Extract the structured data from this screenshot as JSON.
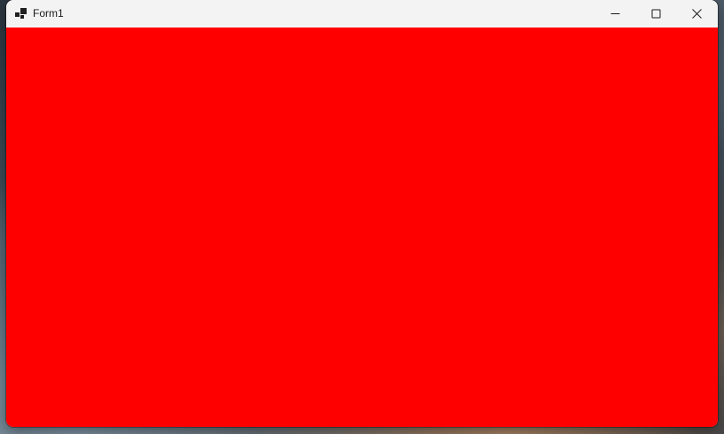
{
  "window": {
    "title": "Form1",
    "client_color": "#ff0000",
    "titlebar_color": "#f3f3f3"
  },
  "titlebar": {
    "app_icon": "winforms-app-icon",
    "buttons": [
      {
        "name": "minimize",
        "icon": "minimize-icon"
      },
      {
        "name": "maximize",
        "icon": "maximize-icon"
      },
      {
        "name": "close",
        "icon": "close-icon"
      }
    ]
  }
}
